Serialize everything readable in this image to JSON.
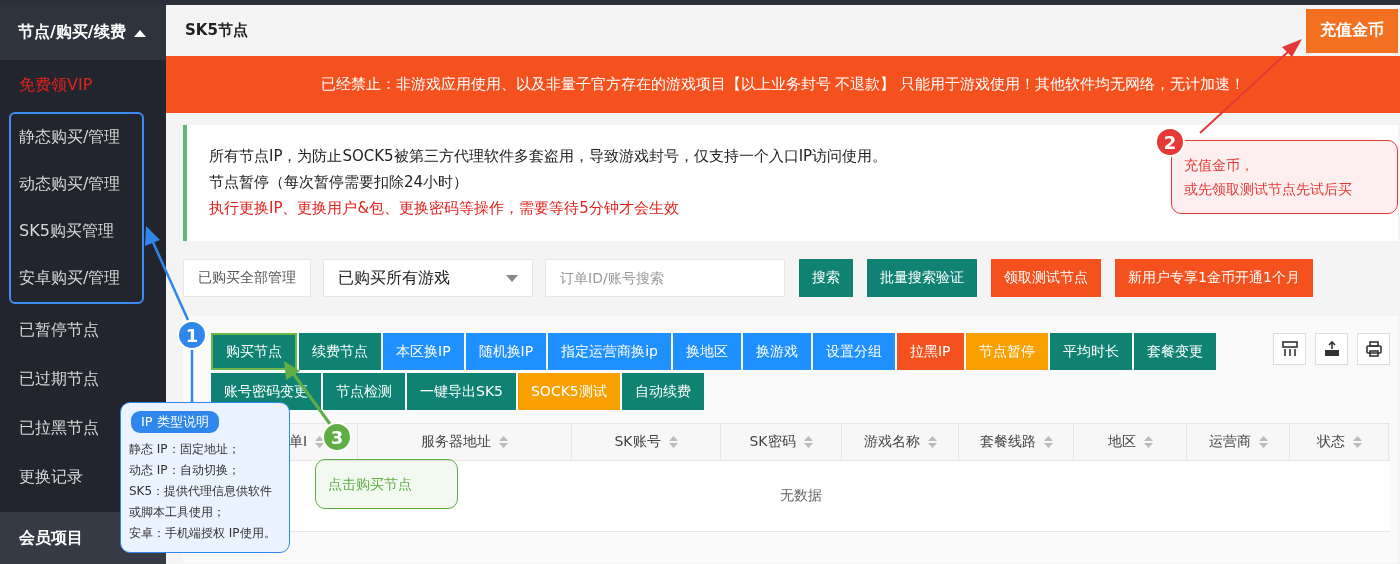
{
  "sidebar": {
    "header": {
      "label": "节点/购买/续费",
      "expanded": true
    },
    "promo": {
      "label": "免费领VIP"
    },
    "outlined_items": [
      {
        "label": "静态购买/管理"
      },
      {
        "label": "动态购买/管理"
      },
      {
        "label": "SK5购买管理"
      },
      {
        "label": "安卓购买/管理"
      }
    ],
    "items": [
      {
        "label": "已暂停节点"
      },
      {
        "label": "已过期节点"
      },
      {
        "label": "已拉黑节点"
      },
      {
        "label": "更换记录"
      }
    ],
    "footer": {
      "label": "会员项目"
    }
  },
  "header": {
    "title": "SK5节点",
    "recharge_button": "充值金币"
  },
  "banner": "已经禁止：非游戏应用使用、以及非量子官方存在的游戏项目【以上业务封号 不退款】 只能用于游戏使用！其他软件均无网络，无计加速！",
  "notice": [
    {
      "kind": "normal",
      "text": "所有节点IP，为防止SOCK5被第三方代理软件多套盗用，导致游戏封号，仅支持一个入口IP访问使用。"
    },
    {
      "kind": "normal",
      "text": "节点暂停（每次暂停需要扣除24小时）"
    },
    {
      "kind": "alert",
      "text": "执行更换IP、更换用户&包、更换密码等操作，需要等待5分钟才会生效"
    }
  ],
  "search": {
    "scope_button": "已购买全部管理",
    "game_select": "已购买所有游戏",
    "placeholder": "订单ID/账号搜索",
    "buttons": [
      {
        "label": "搜索",
        "color": "#0f8273"
      },
      {
        "label": "批量搜索验证",
        "color": "#0f8273"
      },
      {
        "label": "领取测试节点",
        "color": "#f4511e"
      },
      {
        "label": "新用户专享1金币开通1个月",
        "color": "#f4511e"
      }
    ]
  },
  "toolbar": {
    "buttons": [
      {
        "label": "购买节点",
        "color": "#0f8273",
        "highlighted": true
      },
      {
        "label": "续费节点",
        "color": "#0f8273",
        "highlighted": false
      },
      {
        "label": "本区换IP",
        "color": "#1e90ff",
        "highlighted": false
      },
      {
        "label": "随机换IP",
        "color": "#1e90ff",
        "highlighted": false
      },
      {
        "label": "指定运营商换ip",
        "color": "#1e90ff",
        "highlighted": false
      },
      {
        "label": "换地区",
        "color": "#1e90ff",
        "highlighted": false
      },
      {
        "label": "换游戏",
        "color": "#1e90ff",
        "highlighted": false
      },
      {
        "label": "设置分组",
        "color": "#1e90ff",
        "highlighted": false
      },
      {
        "label": "拉黑IP",
        "color": "#f4511e",
        "highlighted": false
      },
      {
        "label": "节点暂停",
        "color": "#f7a000",
        "highlighted": false
      },
      {
        "label": "平均时长",
        "color": "#0f8273",
        "highlighted": false
      },
      {
        "label": "套餐变更",
        "color": "#0f8273",
        "highlighted": false
      },
      {
        "label": "账号密码变更",
        "color": "#0f8273",
        "highlighted": false
      },
      {
        "label": "节点检测",
        "color": "#0f8273",
        "highlighted": false
      },
      {
        "label": "一键导出SK5",
        "color": "#0f8273",
        "highlighted": false
      },
      {
        "label": "SOCK5测试",
        "color": "#f7a000",
        "highlighted": false
      },
      {
        "label": "自动续费",
        "color": "#0f8273",
        "highlighted": false
      }
    ]
  },
  "table": {
    "columns": [
      "单I",
      "服务器地址",
      "SK账号",
      "SK密码",
      "游戏名称",
      "套餐线路",
      "地区",
      "运营商",
      "状态"
    ],
    "empty_text": "无数据"
  },
  "callouts": [
    {
      "number": "1",
      "color": "#2f86eb",
      "title": "IP 类型说明",
      "lines": [
        "静态 IP：固定地址；",
        "动态 IP：自动切换；",
        "SK5：提供代理信息供软件",
        "或脚本工具使用；",
        "安卓：手机端授权 IP使用。"
      ]
    },
    {
      "number": "2",
      "color": "#e53935",
      "lines": [
        "充值金币，",
        "或先领取测试节点先试后买"
      ]
    },
    {
      "number": "3",
      "color": "#5fae45",
      "lines": [
        "点击购买节点"
      ]
    }
  ]
}
